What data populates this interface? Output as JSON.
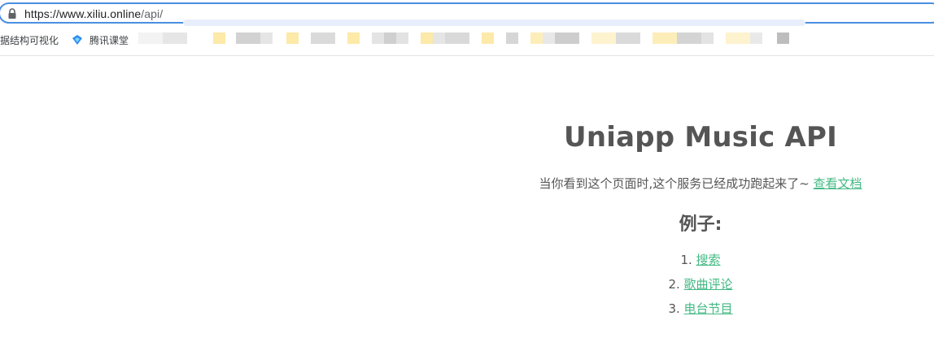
{
  "browser": {
    "url_host": "https://www.xiliu.online",
    "url_path": "/api/",
    "bookmarks": [
      {
        "label": "据结构可视化"
      },
      {
        "label": "腾讯课堂",
        "icon": "tencent-classroom-icon"
      }
    ]
  },
  "page": {
    "title": "Uniapp Music API",
    "status_text": "当你看到这个页面时,这个服务已经成功跑起来了~ ",
    "doc_link": "查看文档",
    "examples_heading": "例子:",
    "examples": [
      {
        "num": "1. ",
        "label": "搜索"
      },
      {
        "num": "2. ",
        "label": "歌曲评论"
      },
      {
        "num": "3. ",
        "label": "电台节目"
      }
    ]
  },
  "colors": {
    "link": "#42b983",
    "text": "#555555",
    "address_focus": "#4a8fe0"
  }
}
